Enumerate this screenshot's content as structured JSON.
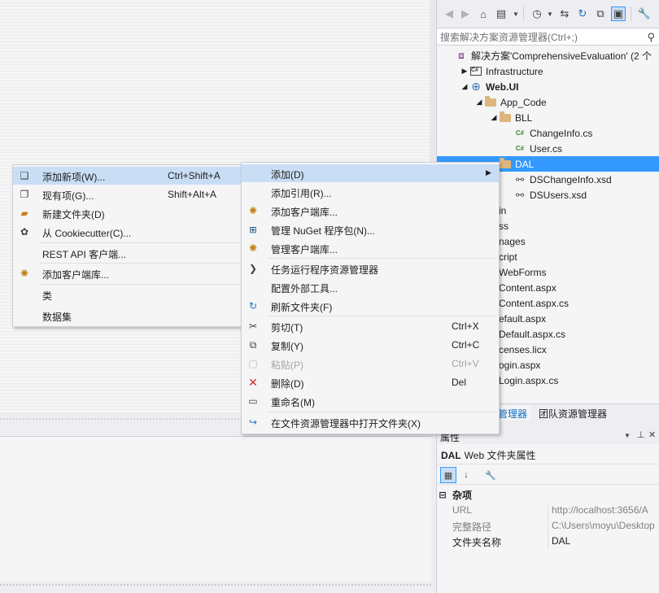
{
  "solution_explorer": {
    "search_placeholder": "搜索解决方案资源管理器(Ctrl+;)",
    "tree": [
      {
        "label": "解决方案'ComprehensiveEvaluation' (2 个",
        "icon": "solution-icon",
        "indent": 0,
        "toggle": ""
      },
      {
        "label": "Infrastructure",
        "icon": "csharp-project-icon",
        "indent": 1,
        "toggle": "▶"
      },
      {
        "label": "Web.UI",
        "icon": "web-project-icon",
        "indent": 1,
        "toggle": "◢"
      },
      {
        "label": "App_Code",
        "icon": "folder-icon",
        "indent": 2,
        "toggle": "◢"
      },
      {
        "label": "BLL",
        "icon": "folder-icon",
        "indent": 3,
        "toggle": "◢"
      },
      {
        "label": "ChangeInfo.cs",
        "icon": "csharp-file-icon",
        "indent": 4,
        "toggle": ""
      },
      {
        "label": "User.cs",
        "icon": "csharp-file-icon",
        "indent": 4,
        "toggle": ""
      },
      {
        "label": "DAL",
        "icon": "folder-icon",
        "indent": 3,
        "toggle": "",
        "selected": true
      },
      {
        "label": "DSChangeInfo.xsd",
        "icon": "dataset-icon",
        "indent": 4,
        "toggle": ""
      },
      {
        "label": "DSUsers.xsd",
        "icon": "dataset-icon",
        "indent": 4,
        "toggle": ""
      },
      {
        "label": "in",
        "icon": "",
        "indent": 3,
        "toggle": ""
      },
      {
        "label": "ss",
        "icon": "",
        "indent": 3,
        "toggle": ""
      },
      {
        "label": "nages",
        "icon": "",
        "indent": 3,
        "toggle": ""
      },
      {
        "label": "cript",
        "icon": "",
        "indent": 3,
        "toggle": ""
      },
      {
        "label": "WebForms",
        "icon": "",
        "indent": 3,
        "toggle": ""
      },
      {
        "label": "Content.aspx",
        "icon": "",
        "indent": 3,
        "toggle": ""
      },
      {
        "label": "Content.aspx.cs",
        "icon": "",
        "indent": 3,
        "toggle": ""
      },
      {
        "label": "efault.aspx",
        "icon": "",
        "indent": 3,
        "toggle": ""
      },
      {
        "label": "Default.aspx.cs",
        "icon": "",
        "indent": 3,
        "toggle": ""
      },
      {
        "label": "censes.licx",
        "icon": "",
        "indent": 3,
        "toggle": ""
      },
      {
        "label": "ogin.aspx",
        "icon": "",
        "indent": 3,
        "toggle": ""
      },
      {
        "label": "Login.aspx.cs",
        "icon": "",
        "indent": 3,
        "toggle": ""
      }
    ],
    "tabs": {
      "active": "管理器",
      "other": "团队资源管理器"
    }
  },
  "properties": {
    "header": "属性",
    "object_name": "DAL",
    "object_type": "Web 文件夹属性",
    "category": "杂项",
    "rows": [
      {
        "name": "URL",
        "value": "http://localhost:3656/A",
        "dim": true
      },
      {
        "name": "完整路径",
        "value": "C:\\Users\\moyu\\Desktop",
        "dim": true
      },
      {
        "name": "文件夹名称",
        "value": "DAL",
        "dim": false
      }
    ]
  },
  "context_menu": {
    "items": {
      "add": "添加(D)",
      "add_reference": "添加引用(R)...",
      "add_client_library": "添加客户端库...",
      "manage_nuget": "管理 NuGet 程序包(N)...",
      "manage_client_libraries": "管理客户端库...",
      "task_runner": "任务运行程序资源管理器",
      "config_external_tools": "配置外部工具...",
      "refresh_folder": "刷新文件夹(F)",
      "cut": "剪切(T)",
      "copy": "复制(Y)",
      "paste": "粘贴(P)",
      "delete": "删除(D)",
      "rename": "重命名(M)",
      "open_in_explorer": "在文件资源管理器中打开文件夹(X)"
    },
    "shortcuts": {
      "cut": "Ctrl+X",
      "copy": "Ctrl+C",
      "paste": "Ctrl+V",
      "delete": "Del"
    }
  },
  "add_submenu": {
    "items": {
      "new_item": "添加新项(W)...",
      "existing_item": "现有项(G)...",
      "new_folder": "新建文件夹(D)",
      "from_cookiecutter": "从 Cookiecutter(C)...",
      "rest_api_client": "REST API 客户端...",
      "add_client_library": "添加客户端库...",
      "class": "类",
      "dataset": "数据集"
    },
    "shortcuts": {
      "new_item": "Ctrl+Shift+A",
      "existing_item": "Shift+Alt+A"
    }
  }
}
